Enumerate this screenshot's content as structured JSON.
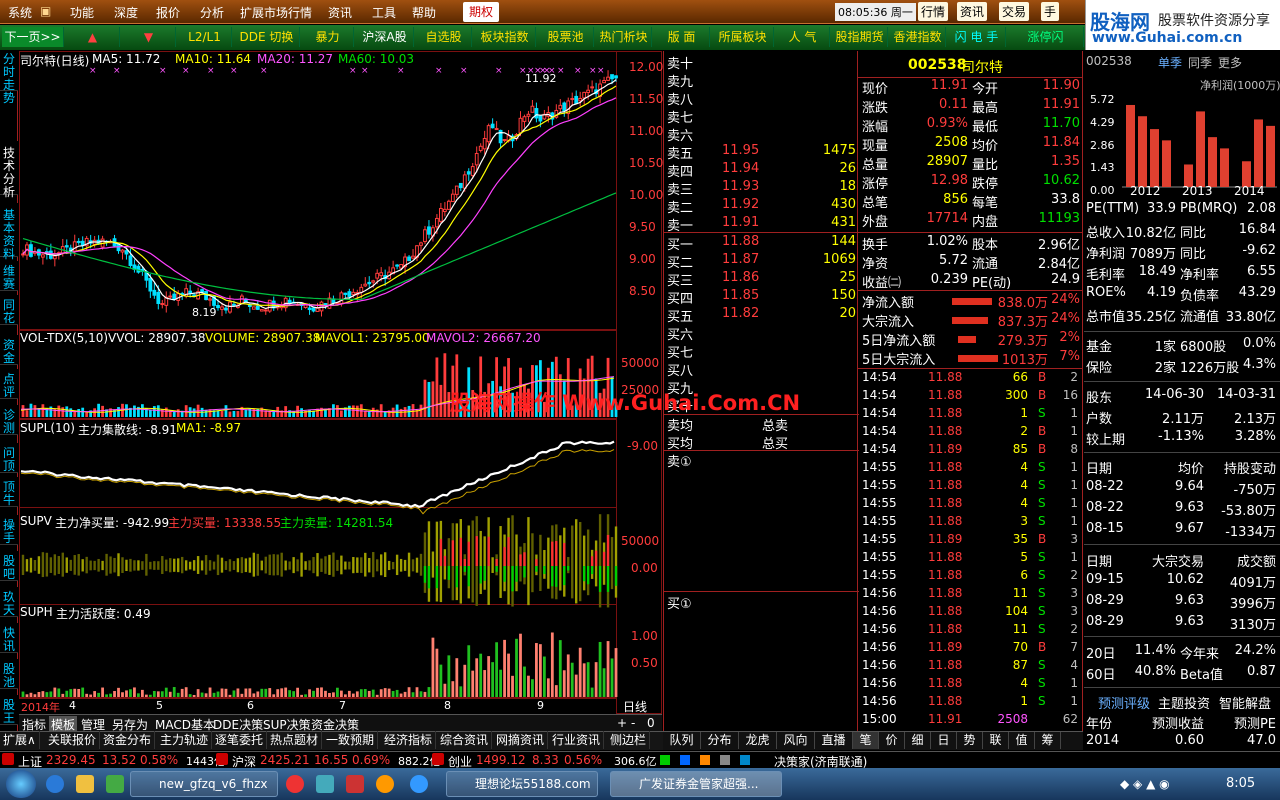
{
  "menu": [
    "系统",
    "功能",
    "深度",
    "报价",
    "分析",
    "扩展市场行情",
    "资讯",
    "工具",
    "帮助"
  ],
  "menu_futures": "期权",
  "menu_clock": "08:05:36 周一",
  "menu_right": [
    "行情",
    "资讯",
    "交易",
    "手"
  ],
  "logo": {
    "brand": "股海网",
    "slogan": "股票软件资源分享",
    "url": "www.Guhai.com.cn"
  },
  "toolbar": [
    "下一页>>",
    "▲",
    "▼",
    "L2/L1",
    "DDE 切换",
    "暴力",
    "沪深A股",
    "自选股",
    "板块指数",
    "股票池",
    "热门析块",
    "版 面",
    "所属板块",
    "人 气",
    "股指期货",
    "香港指数",
    "闪 电 手",
    "涨停闪"
  ],
  "left_tabs": [
    "分时走势",
    "技术分析",
    "基本资料",
    "维赛",
    "同花",
    "资金",
    "点评",
    "诊测",
    "问顶",
    "顶牛",
    "操手",
    "股吧",
    "玖天",
    "快讯",
    "股池",
    "股王"
  ],
  "chart_title": {
    "name": "司尔特(日线)",
    "ma5": "MA5: 11.72",
    "ma10": "MA10: 11.64",
    "ma20": "MA20: 11.27",
    "ma60": "MA60: 10.03"
  },
  "price_axis": [
    "12.00",
    "11.50",
    "11.00",
    "10.50",
    "10.00",
    "9.50",
    "9.00",
    "8.50"
  ],
  "hi_label": "11.92",
  "lo_label": "8.19",
  "vol_title": {
    "a": "VOL-TDX(5,10)",
    "b": "VVOL: 28907.38",
    "c": "VOLUME: 28907.38",
    "d": "MAVOL1: 23795.00",
    "e": "MAVOL2: 26667.20"
  },
  "vol_axis": [
    "50000",
    "25000"
  ],
  "supl_title": {
    "a": "SUPL(10)",
    "b": "主力集散线: -8.91",
    "c": "MA1: -8.97"
  },
  "supl_axis": "-9.00",
  "supv_title": {
    "a": "SUPV",
    "b": "主力净买量: -942.99",
    "c": "主力买量: 13338.55",
    "d": "主力卖量: 14281.54"
  },
  "supv_axis": [
    "50000",
    "0.00"
  ],
  "suph_title": {
    "a": "SUPH",
    "b": "主力活跃度: 0.49"
  },
  "suph_axis": [
    "1.00",
    "0.50"
  ],
  "date_axis": {
    "year": "2014年",
    "m": [
      "4",
      "5",
      "6",
      "7",
      "8",
      "9"
    ],
    "period": "日线"
  },
  "watermark": "股海网操作 Www.Guhai.Com.CN",
  "chart_tabs": [
    "指标",
    "模板",
    "管理",
    "另存为",
    "MACD基本",
    "DDE决策",
    "SUP决策",
    "资金决策"
  ],
  "orderbook": {
    "sell_labels": [
      "卖十",
      "卖九",
      "卖八",
      "卖七",
      "卖六",
      "卖五",
      "卖四",
      "卖三",
      "卖二",
      "卖一"
    ],
    "sell": [
      {
        "p": "11.95",
        "v": "1475"
      },
      {
        "p": "11.94",
        "v": "26"
      },
      {
        "p": "11.93",
        "v": "18"
      },
      {
        "p": "11.92",
        "v": "430"
      },
      {
        "p": "11.91",
        "v": "431"
      }
    ],
    "buy_labels": [
      "买一",
      "买二",
      "买三",
      "买四",
      "买五",
      "买六",
      "买七",
      "买八",
      "买九",
      "买十"
    ],
    "buy": [
      {
        "p": "11.88",
        "v": "144"
      },
      {
        "p": "11.87",
        "v": "1069"
      },
      {
        "p": "11.86",
        "v": "25"
      },
      {
        "p": "11.85",
        "v": "150"
      },
      {
        "p": "11.82",
        "v": "20"
      }
    ],
    "avg": [
      "卖均",
      "总卖",
      "买均",
      "总买"
    ],
    "q1": "卖①",
    "q2": "买①"
  },
  "quote": {
    "code": "002538",
    "name": "司尔特",
    "rows": [
      [
        "现价",
        "11.91",
        "今开",
        "11.90"
      ],
      [
        "涨跌",
        "0.11",
        "最高",
        "11.91"
      ],
      [
        "涨幅",
        "0.93%",
        "最低",
        "11.70"
      ],
      [
        "现量",
        "2508",
        "均价",
        "11.84"
      ],
      [
        "总量",
        "28907",
        "量比",
        "1.35"
      ],
      [
        "涨停",
        "12.98",
        "跌停",
        "10.62"
      ],
      [
        "总笔",
        "856",
        "每笔",
        "33.8"
      ],
      [
        "外盘",
        "17714",
        "内盘",
        "11193"
      ]
    ],
    "rows2": [
      [
        "换手",
        "1.02%",
        "股本",
        "2.96亿"
      ],
      [
        "净资",
        "5.72",
        "流通",
        "2.84亿"
      ],
      [
        "收益㈡",
        "0.239",
        "PE(动)",
        "24.9"
      ]
    ],
    "flow": [
      [
        "净流入额",
        "838.0万",
        "24%"
      ],
      [
        "大宗流入",
        "837.3万",
        "24%"
      ],
      [
        "5日净流入额",
        "279.3万",
        "2%"
      ],
      [
        "5日大宗流入",
        "1013万",
        "7%"
      ]
    ]
  },
  "ticks": [
    [
      "14:54",
      "11.88",
      "66",
      "B",
      "2"
    ],
    [
      "14:54",
      "11.88",
      "300",
      "B",
      "16"
    ],
    [
      "14:54",
      "11.88",
      "1",
      "S",
      "1"
    ],
    [
      "14:54",
      "11.88",
      "2",
      "B",
      "1"
    ],
    [
      "14:54",
      "11.89",
      "85",
      "B",
      "8"
    ],
    [
      "14:55",
      "11.88",
      "4",
      "S",
      "1"
    ],
    [
      "14:55",
      "11.88",
      "4",
      "S",
      "1"
    ],
    [
      "14:55",
      "11.88",
      "4",
      "S",
      "1"
    ],
    [
      "14:55",
      "11.88",
      "3",
      "S",
      "1"
    ],
    [
      "14:55",
      "11.89",
      "35",
      "B",
      "3"
    ],
    [
      "14:55",
      "11.88",
      "5",
      "S",
      "1"
    ],
    [
      "14:55",
      "11.88",
      "6",
      "S",
      "2"
    ],
    [
      "14:56",
      "11.88",
      "11",
      "S",
      "3"
    ],
    [
      "14:56",
      "11.88",
      "104",
      "S",
      "3"
    ],
    [
      "14:56",
      "11.88",
      "11",
      "S",
      "2"
    ],
    [
      "14:56",
      "11.89",
      "70",
      "B",
      "7"
    ],
    [
      "14:56",
      "11.88",
      "87",
      "S",
      "4"
    ],
    [
      "14:56",
      "11.88",
      "4",
      "S",
      "1"
    ],
    [
      "14:56",
      "11.88",
      "1",
      "S",
      "1"
    ],
    [
      "15:00",
      "11.91",
      "2508",
      "",
      "62"
    ]
  ],
  "right_tabs": [
    "队列",
    "分布",
    "龙虎",
    "风向",
    "直播",
    "笔",
    "价",
    "细",
    "日",
    "势",
    "联",
    "值",
    "筹"
  ],
  "fin": {
    "code": "002538",
    "tab": "单季",
    "tab2": "同季",
    "more": "更多",
    "unit": "净利润(1000万)",
    "yaxis": [
      "5.72",
      "4.29",
      "2.86",
      "1.43",
      "0.00"
    ],
    "years": [
      "2012",
      "2013",
      "2014"
    ],
    "bars": [
      5.1,
      4.4,
      3.6,
      2.9,
      1.4,
      4.7,
      3.1,
      2.4,
      1.6,
      4.2,
      3.8,
      1.3
    ]
  },
  "fin_rows": [
    [
      "PE(TTM)",
      "33.9",
      "PB(MRQ)",
      "2.08"
    ],
    [
      "总收入",
      "10.82亿",
      "同比",
      "16.84"
    ],
    [
      "净利润",
      "7089万",
      "同比",
      "-9.62"
    ],
    [
      "毛利率",
      "18.49",
      "净利率",
      "6.55"
    ],
    [
      "ROE%",
      "4.19",
      "负债率",
      "43.29"
    ],
    [
      "总市值",
      "35.25亿",
      "流通值",
      "33.80亿"
    ]
  ],
  "fund_rows": [
    [
      "基金",
      "1家",
      "6800股",
      "0.0%"
    ],
    [
      "保险",
      "2家",
      "1226万股",
      "4.3%"
    ]
  ],
  "holder": {
    "h": [
      "股东",
      "14-06-30",
      "14-03-31"
    ],
    "r1": [
      "户数",
      "2.11万",
      "2.13万"
    ],
    "r2": [
      "较上期",
      "-1.13%",
      "3.28%"
    ]
  },
  "trade": {
    "h": [
      "日期",
      "均价",
      "持股变动"
    ],
    "rows": [
      [
        "08-22",
        "9.64",
        "-750万"
      ],
      [
        "08-22",
        "9.63",
        "-53.80万"
      ],
      [
        "08-15",
        "9.67",
        "-1334万"
      ]
    ]
  },
  "block": {
    "h": [
      "日期",
      "大宗交易",
      "成交额"
    ],
    "rows": [
      [
        "09-15",
        "10.62",
        "4091万"
      ],
      [
        "08-29",
        "9.63",
        "3996万"
      ],
      [
        "08-29",
        "9.63",
        "3130万"
      ]
    ]
  },
  "rank": [
    [
      "20日",
      "11.4%",
      "今年来",
      "24.2%"
    ],
    [
      "60日",
      "40.8%",
      "Beta值",
      "0.87"
    ]
  ],
  "pred": {
    "tabs": [
      "预测评级",
      "主题投资",
      "智能解盘"
    ],
    "h": [
      "年份",
      "预测收益",
      "预测PE"
    ],
    "r": [
      "2014",
      "0.60",
      "47.0"
    ]
  },
  "bottom_tabs": [
    "扩展∧",
    "关联报价",
    "资金分布",
    "主力轨迹",
    "逐笔委托",
    "热点题材",
    "一致预期",
    "经济指标",
    "综合资讯",
    "网摘资讯",
    "行业资讯",
    "侧边栏"
  ],
  "status": {
    "sh": "上证",
    "sh_v": "2329.45",
    "sh_c": "13.52",
    "sh_p": "0.58%",
    "sh_a": "1443亿",
    "sz": "沪深",
    "sz_v": "2425.21",
    "sz_c": "16.55",
    "sz_p": "0.69%",
    "sz_a": "882.2亿",
    "cy": "创业",
    "cy_v": "1499.12",
    "cy_c": "8.33",
    "cy_p": "0.56%",
    "cy_a": "306.6亿",
    "right": "决策家(济南联通)"
  },
  "taskbar": {
    "tasks": [
      "new_gfzq_v6_fhzx",
      "理想论坛55188.com",
      "广发证券金管家超强..."
    ],
    "time": "8:05"
  },
  "colors": {
    "up": "#ff3c3c",
    "down": "#00e000",
    "bg": "#000000"
  }
}
